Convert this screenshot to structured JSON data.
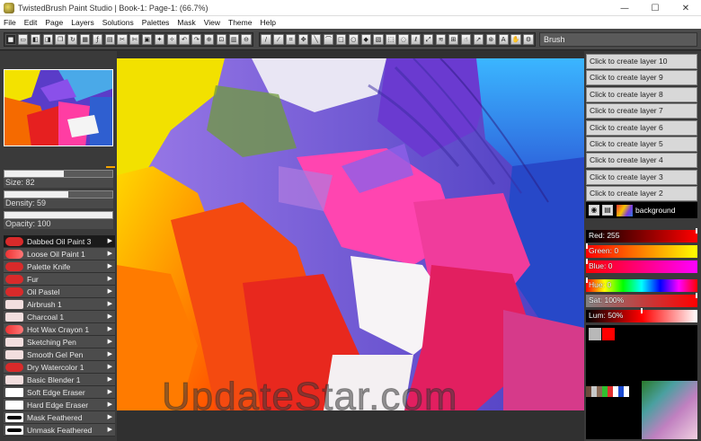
{
  "window": {
    "title": "TwistedBrush Paint Studio | Book-1: Page-1: (66.7%)",
    "minimize": "—",
    "maximize": "☐",
    "close": "✕"
  },
  "menu": [
    "File",
    "Edit",
    "Page",
    "Layers",
    "Solutions",
    "Palettes",
    "Mask",
    "View",
    "Theme",
    "Help"
  ],
  "toolbar": {
    "brush_field": "Brush"
  },
  "left": {
    "size_label": "Size: 82",
    "size_value": 0.55,
    "density_label": "Density: 59",
    "density_value": 0.59,
    "opacity_label": "Opacity: 100",
    "opacity_value": 1.0,
    "brushes": [
      {
        "name": "Dabbed Oil Paint 3",
        "swatch": "red",
        "selected": true
      },
      {
        "name": "Loose Oil Paint 1",
        "swatch": "red2",
        "selected": false
      },
      {
        "name": "Palette Knife",
        "swatch": "red",
        "selected": false
      },
      {
        "name": "Fur",
        "swatch": "red",
        "selected": false
      },
      {
        "name": "Oil Pastel",
        "swatch": "red",
        "selected": false
      },
      {
        "name": "Airbrush 1",
        "swatch": "pale",
        "selected": false
      },
      {
        "name": "Charcoal 1",
        "swatch": "pale",
        "selected": false
      },
      {
        "name": "Hot Wax Crayon 1",
        "swatch": "red2",
        "selected": false
      },
      {
        "name": "Sketching Pen",
        "swatch": "pale",
        "selected": false
      },
      {
        "name": "Smooth Gel Pen",
        "swatch": "pale",
        "selected": false
      },
      {
        "name": "Dry Watercolor 1",
        "swatch": "red",
        "selected": false
      },
      {
        "name": "Basic Blender 1",
        "swatch": "pale",
        "selected": false
      },
      {
        "name": "Soft Edge Eraser",
        "swatch": "white",
        "selected": false
      },
      {
        "name": "Hard Edge Eraser",
        "swatch": "white",
        "selected": false
      },
      {
        "name": "Mask Feathered",
        "swatch": "black",
        "selected": false
      },
      {
        "name": "Unmask Feathered",
        "swatch": "black",
        "selected": false
      }
    ]
  },
  "layers": {
    "create_buttons": [
      "Click to create layer 10",
      "Click to create layer 9",
      "Click to create layer 8",
      "Click to create layer 7",
      "Click to create layer 6",
      "Click to create layer 5",
      "Click to create layer 4",
      "Click to create layer 3",
      "Click to create layer 2"
    ],
    "background_label": "background"
  },
  "color": {
    "red_label": "Red: 255",
    "red_value": 1.0,
    "green_label": "Green: 0",
    "green_value": 0.0,
    "blue_label": "Blue: 0",
    "blue_value": 0.0,
    "hue_label": "Hue: 0",
    "hue_value": 0.0,
    "sat_label": "Sat: 100%",
    "sat_value": 1.0,
    "lum_label": "Lum: 50%",
    "lum_value": 0.5,
    "primary": "#ff0000",
    "secondary": "#b8b8b8"
  },
  "watermark": "UpdateStar.com"
}
